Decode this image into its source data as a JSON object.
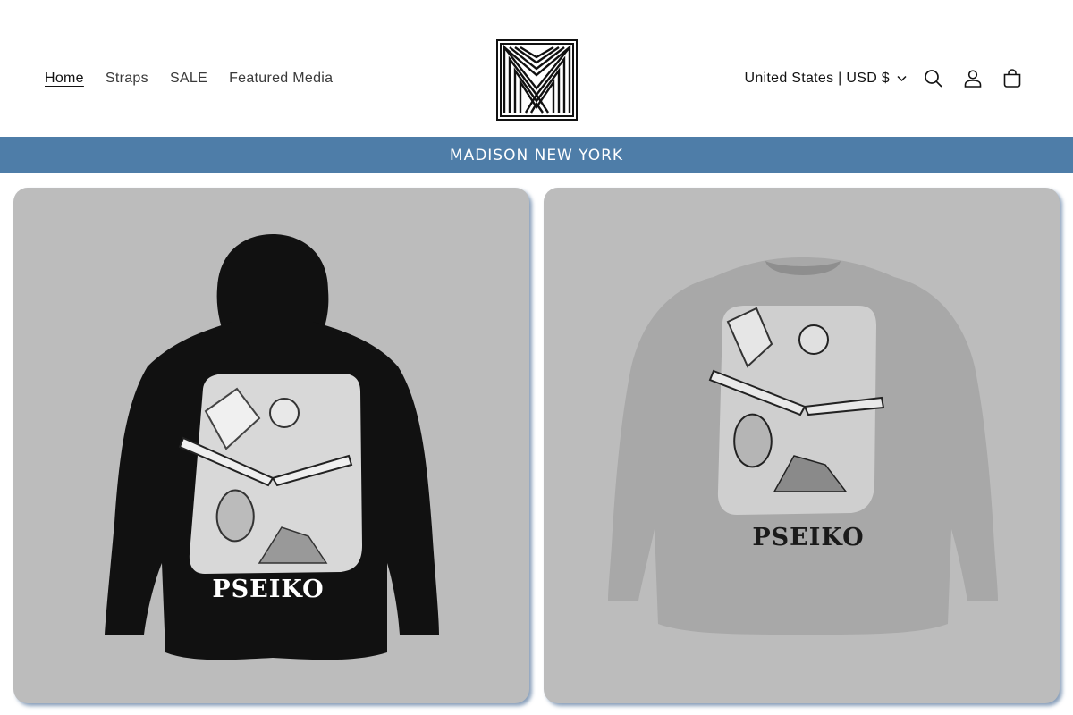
{
  "nav": {
    "items": [
      {
        "label": "Home",
        "active": true
      },
      {
        "label": "Straps",
        "active": false
      },
      {
        "label": "SALE",
        "active": false
      },
      {
        "label": "Featured Media",
        "active": false
      }
    ]
  },
  "logo": {
    "icon": "monogram-m-logo"
  },
  "tools": {
    "country_label": "United States | USD $",
    "icons": [
      "search-icon",
      "account-icon",
      "cart-icon"
    ]
  },
  "announcement": {
    "text": "MADISON NEW YORK"
  },
  "products": [
    {
      "brand_print": "PSEIKO",
      "garment": "black hoodie",
      "garment_color": "#111111"
    },
    {
      "brand_print": "PSEIKO",
      "garment": "grey crewneck sweatshirt",
      "garment_color": "#a9a9a9"
    }
  ],
  "colors": {
    "announcement_bg": "#4e7da8",
    "card_bg": "#bcbcbc",
    "text": "#121212"
  }
}
